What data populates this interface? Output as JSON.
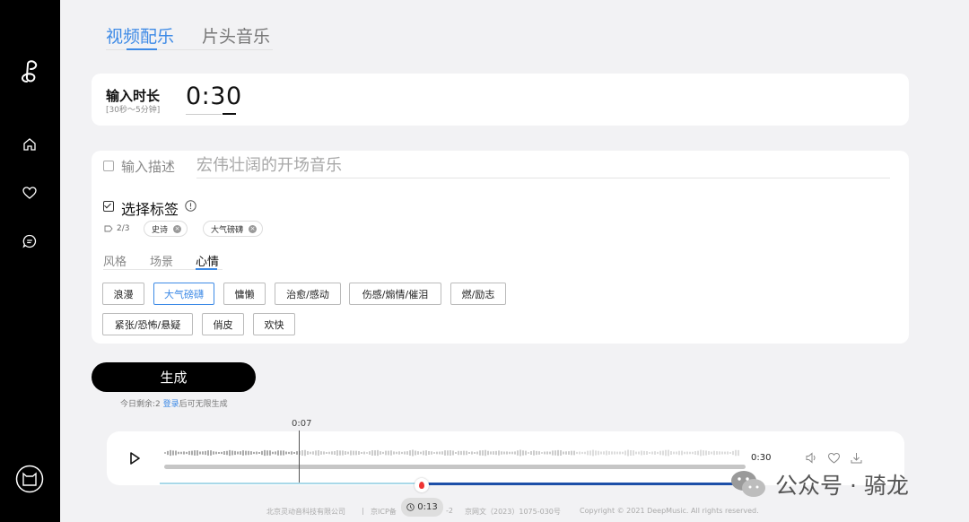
{
  "tabs": [
    {
      "label": "视频配乐"
    },
    {
      "label": "片头音乐"
    }
  ],
  "duration": {
    "label": "输入时长",
    "hint": "[30秒～5分钟]",
    "value": "0:30"
  },
  "description": {
    "label": "输入描述",
    "placeholder": "宏伟壮阔的开场音乐"
  },
  "tags": {
    "title": "选择标签",
    "count": "2/3",
    "selected": [
      "史诗",
      "大气磅礴"
    ],
    "categories": [
      "风格",
      "场景",
      "心情"
    ],
    "options": [
      "浪漫",
      "大气磅礴",
      "慵懒",
      "治愈/感动",
      "伤感/煽情/催泪",
      "燃/励志",
      "紧张/恐怖/悬疑",
      "俏皮",
      "欢快"
    ]
  },
  "generate": {
    "label": "生成",
    "remaining": "今日剩余:2",
    "login": "登录",
    "suffix": "后可无限生成"
  },
  "player": {
    "cursor_time": "0:07",
    "total_time": "0:30"
  },
  "timeline": {
    "position_time": "0:13"
  },
  "footer": {
    "company": "北京灵动音科技有限公司",
    "sep": "|",
    "icp": "京ICP备",
    "icp_tail": "-2",
    "netcult": "京网文（2023）1075-030号",
    "copyright": "Copyright © 2021 DeepMusic. All rights reserved."
  },
  "watermark": {
    "text": "公众号 · 骑龙"
  },
  "colors": {
    "accent": "#3d8ae6",
    "sidebar": "#000000",
    "timeline_progress": "#1d4fa8"
  }
}
